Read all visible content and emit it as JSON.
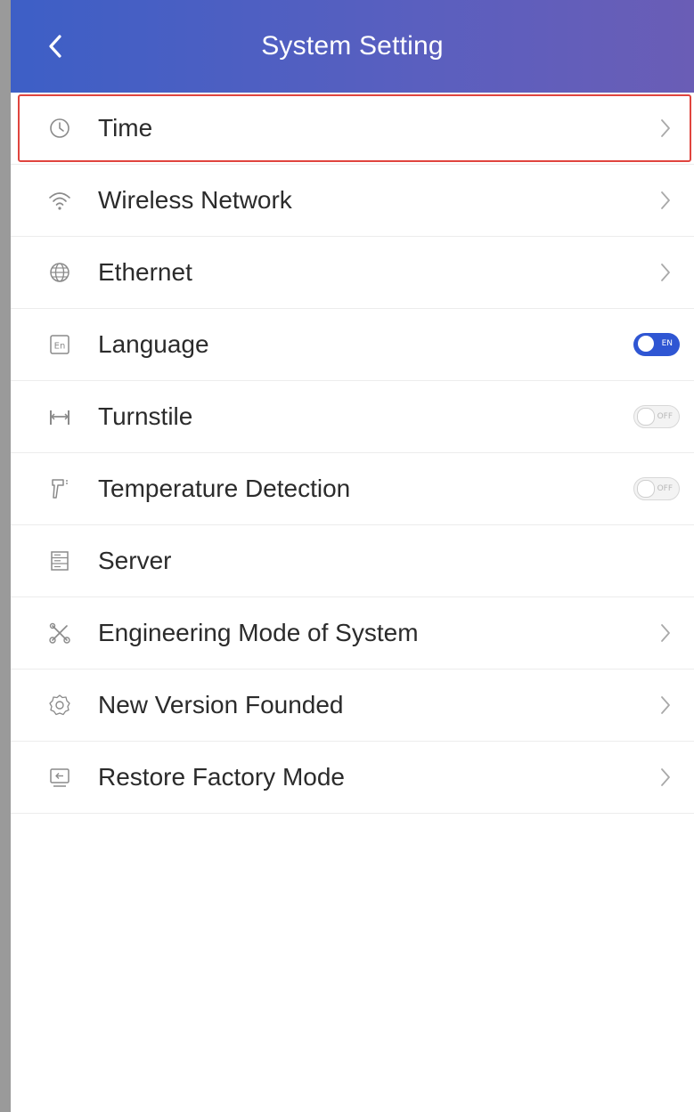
{
  "header": {
    "title": "System Setting",
    "back_icon": "chevron-left-icon",
    "colors": [
      "#3d5fc6",
      "#6a5db6"
    ]
  },
  "items": [
    {
      "label": "Time",
      "icon": "clock-icon",
      "control": "chevron",
      "highlighted": true
    },
    {
      "label": "Wireless Network",
      "icon": "wifi-icon",
      "control": "chevron"
    },
    {
      "label": "Ethernet",
      "icon": "globe-icon",
      "control": "chevron"
    },
    {
      "label": "Language",
      "icon": "language-en-icon",
      "control": "toggle",
      "toggle_state": "on",
      "toggle_text": "EN"
    },
    {
      "label": "Turnstile",
      "icon": "turnstile-icon",
      "control": "toggle",
      "toggle_state": "off",
      "toggle_text": "OFF"
    },
    {
      "label": "Temperature Detection",
      "icon": "thermometer-gun-icon",
      "control": "toggle",
      "toggle_state": "off",
      "toggle_text": "OFF"
    },
    {
      "label": "Server",
      "icon": "server-icon",
      "control": "none"
    },
    {
      "label": "Engineering Mode of System",
      "icon": "tools-icon",
      "control": "chevron"
    },
    {
      "label": "New Version Founded",
      "icon": "gear-icon",
      "control": "chevron"
    },
    {
      "label": "Restore Factory Mode",
      "icon": "restore-icon",
      "control": "chevron"
    }
  ],
  "colors": {
    "accent": "#2f56d3",
    "highlight_border": "#e0443e",
    "text": "#2b2b2b",
    "icon": "#8a8a8a"
  }
}
